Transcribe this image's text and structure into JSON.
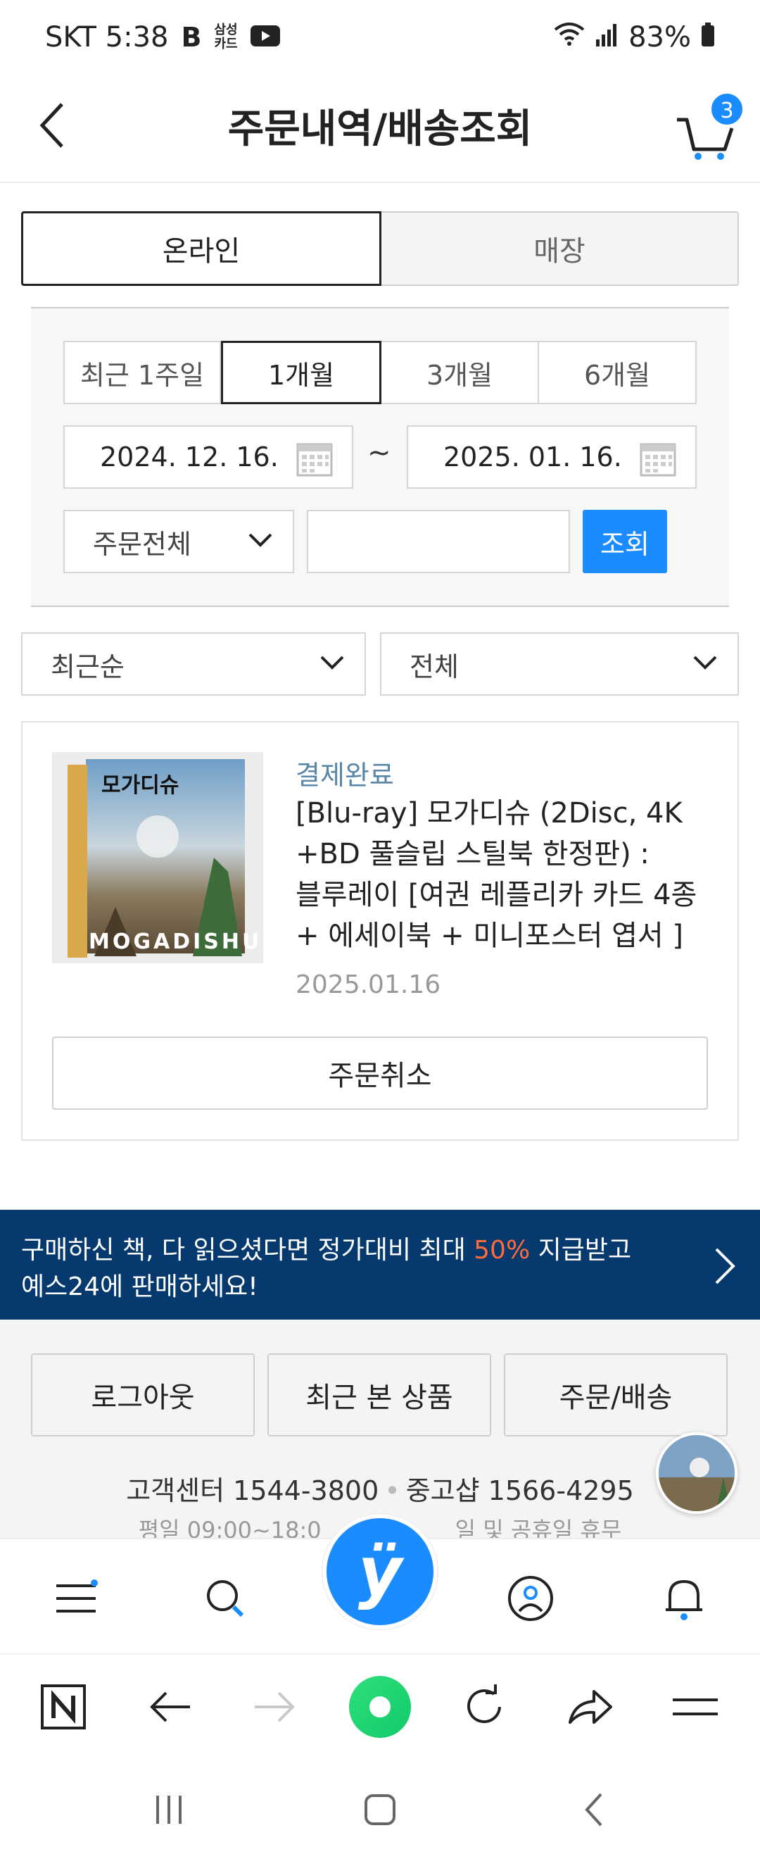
{
  "status_bar": {
    "carrier_time": "SKT 5:38",
    "notif_app_b": "B",
    "notif_card": "삼성\n카드",
    "battery": "83%"
  },
  "header": {
    "title": "주문내역/배송조회",
    "cart_count": "3"
  },
  "channel_tabs": [
    {
      "label": "온라인",
      "active": true
    },
    {
      "label": "매장",
      "active": false
    }
  ],
  "period_tabs": [
    {
      "label": "최근 1주일",
      "active": false
    },
    {
      "label": "1개월",
      "active": true
    },
    {
      "label": "3개월",
      "active": false
    },
    {
      "label": "6개월",
      "active": false
    }
  ],
  "date_range": {
    "start": "2024. 12. 16.",
    "separator": "~",
    "end": "2025. 01. 16."
  },
  "order_type_select": "주문전체",
  "keyword_input": {
    "value": "",
    "placeholder": ""
  },
  "search_button": "조회",
  "sort_select": "최근순",
  "status_select": "전체",
  "order": {
    "status": "결제완료",
    "title": "[Blu-ray] 모가디슈 (2Disc, 4K +BD 풀슬립 스틸북 한정판) : 블루레이 [여권 레플리카 카드 4종 + 에세이북 + 미니포스터 엽서 ]",
    "date": "2025.01.16",
    "cover_title": "모가디슈",
    "cover_subtitle": "MOGADISHU",
    "cancel_label": "주문취소"
  },
  "promo": {
    "line1_pre": "구매하신 책, 다 읽으셨다면 정가대비 최대 ",
    "line1_highlight": "50%",
    "line1_post": " 지급받고",
    "line2": "예스24에 판매하세요!",
    "highlight_color": "#ff6a3d",
    "bg_color": "#063a6e"
  },
  "footer": {
    "buttons": [
      "로그아웃",
      "최근 본 상품",
      "주문/배송"
    ],
    "cs_center": "고객센터 1544-3800",
    "used_shop": "중고샵 1566-4295",
    "hours_left": "평일 09:00~18:0",
    "hours_right": "일 및 공휴일 휴무"
  },
  "app_nav": {
    "icons": [
      "menu-icon",
      "search-icon",
      "yes24-home-icon",
      "my-page-icon",
      "notification-bell-icon"
    ],
    "center_glyph": "ÿ",
    "accent": "#1a8cff"
  },
  "browser_toolbar": {
    "icons": [
      "naver-n-icon",
      "back-arrow-icon",
      "forward-arrow-icon",
      "naver-green-dot-icon",
      "refresh-icon",
      "share-icon",
      "browser-menu-icon"
    ]
  },
  "system_nav": {
    "icons": [
      "recents-icon",
      "home-icon",
      "back-icon"
    ]
  }
}
